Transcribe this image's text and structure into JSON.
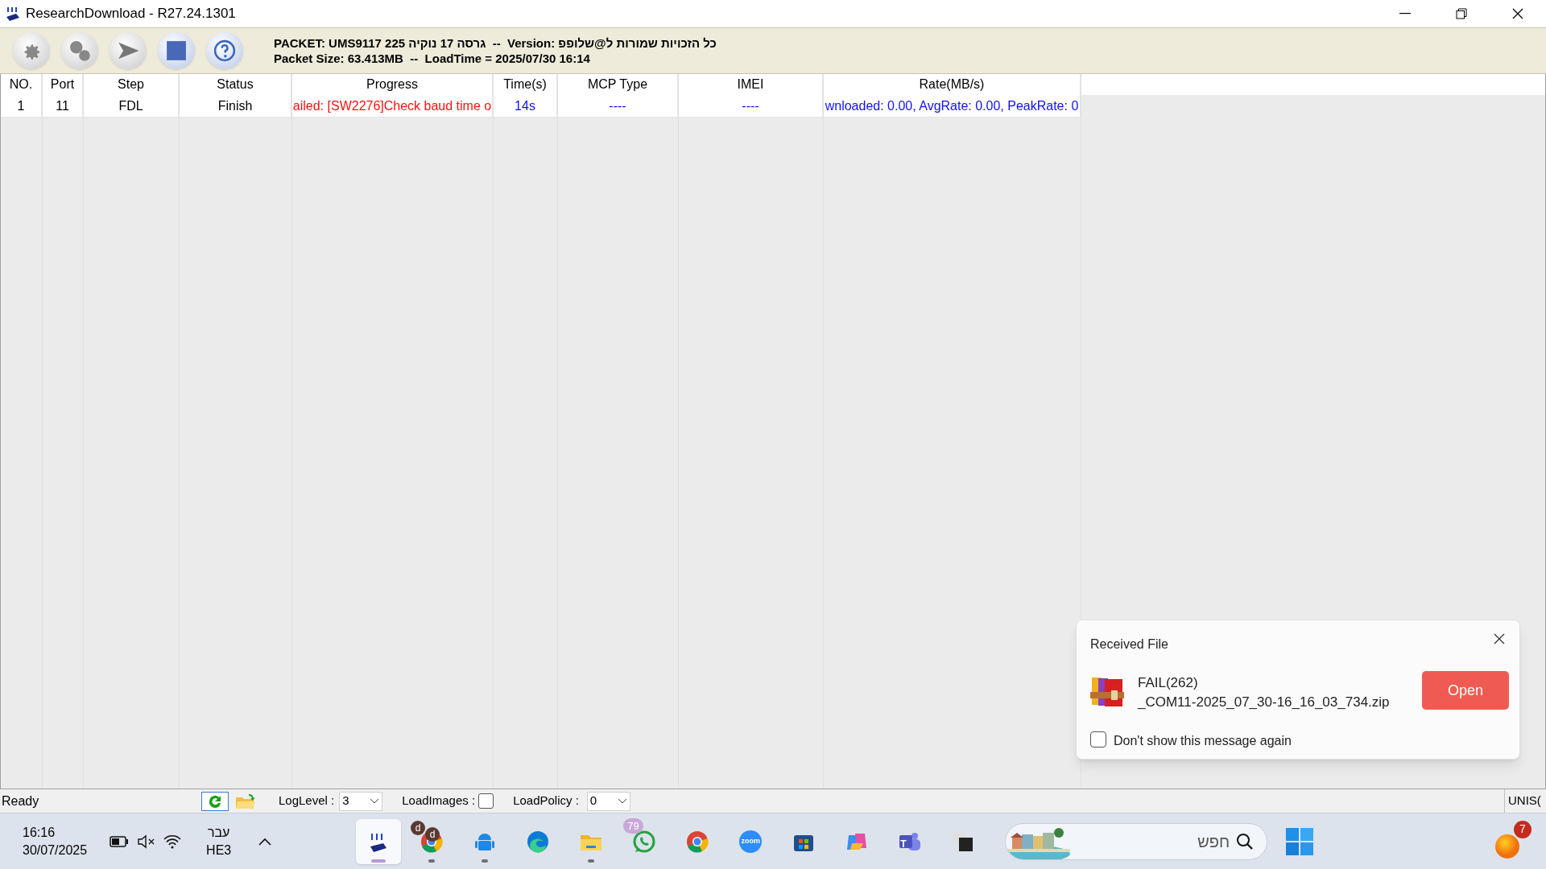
{
  "window": {
    "title": "ResearchDownload - R27.24.1301"
  },
  "toolbar": {
    "buttons": [
      {
        "kind": "settings"
      },
      {
        "kind": "gears"
      },
      {
        "kind": "start"
      },
      {
        "kind": "stop"
      },
      {
        "kind": "help"
      }
    ],
    "packet_info": [
      "PACKET: UMS9117 225 גרסה 17 נוקיה  --  Version: כל הזכויות שמורות ל@שלופפ",
      "Packet Size: 63.413MB  --  LoadTime = 2025/07/30 16:14"
    ]
  },
  "table": {
    "columns": [
      "NO.",
      "Port",
      "Step",
      "Status",
      "Progress",
      "Time(s)",
      "MCP Type",
      "IMEI",
      "Rate(MB/s)"
    ],
    "rows": [
      {
        "cells": [
          {
            "text": "1",
            "kind": "plain"
          },
          {
            "text": "11",
            "kind": "plain"
          },
          {
            "text": "FDL",
            "kind": "plain"
          },
          {
            "text": "Finish",
            "kind": "plain"
          },
          {
            "text": "ailed: [SW2276]Check baud time o",
            "kind": "error"
          },
          {
            "text": "14s",
            "kind": "info"
          },
          {
            "text": "----",
            "kind": "info"
          },
          {
            "text": "----",
            "kind": "info"
          },
          {
            "text": "wnloaded: 0.00, AvgRate: 0.00, PeakRate: 0",
            "kind": "info"
          }
        ]
      }
    ]
  },
  "status_bar": {
    "status": "Ready",
    "log_level": {
      "label": "LogLevel :",
      "value": "3"
    },
    "load_images": {
      "label": "LoadImages :",
      "checked": false
    },
    "load_policy": {
      "label": "LoadPolicy :",
      "value": "0"
    },
    "right_text": "UNIS("
  },
  "notification": {
    "title": "Received File",
    "file_name": [
      "FAIL(262)",
      "_COM11-2025_07_30-16_16_03_734.zip"
    ],
    "button": "Open",
    "checkbox": {
      "label": "Don't show this message again",
      "checked": false
    }
  },
  "taskbar": {
    "time": "16:16",
    "date": "30/07/2025",
    "language": [
      "עבר",
      "HE3"
    ],
    "apps": [
      {
        "kind": "download",
        "selected": true
      },
      {
        "kind": "chrome",
        "selected": false,
        "running": true,
        "badges": [
          "d",
          "d"
        ]
      },
      {
        "kind": "android",
        "selected": false,
        "running": true
      },
      {
        "kind": "edge",
        "selected": false
      },
      {
        "kind": "files",
        "selected": false,
        "running": true
      },
      {
        "kind": "whatsapp",
        "selected": false,
        "badge": "79"
      },
      {
        "kind": "chrome",
        "selected": false
      },
      {
        "kind": "zoom",
        "selected": false,
        "label": "zoom"
      },
      {
        "kind": "store",
        "selected": false
      },
      {
        "kind": "copilot",
        "selected": false
      },
      {
        "kind": "teams",
        "selected": false,
        "label": "T"
      },
      {
        "kind": "window",
        "selected": false
      }
    ],
    "search": {
      "placeholder": "חפש"
    },
    "notification_count": "7"
  }
}
